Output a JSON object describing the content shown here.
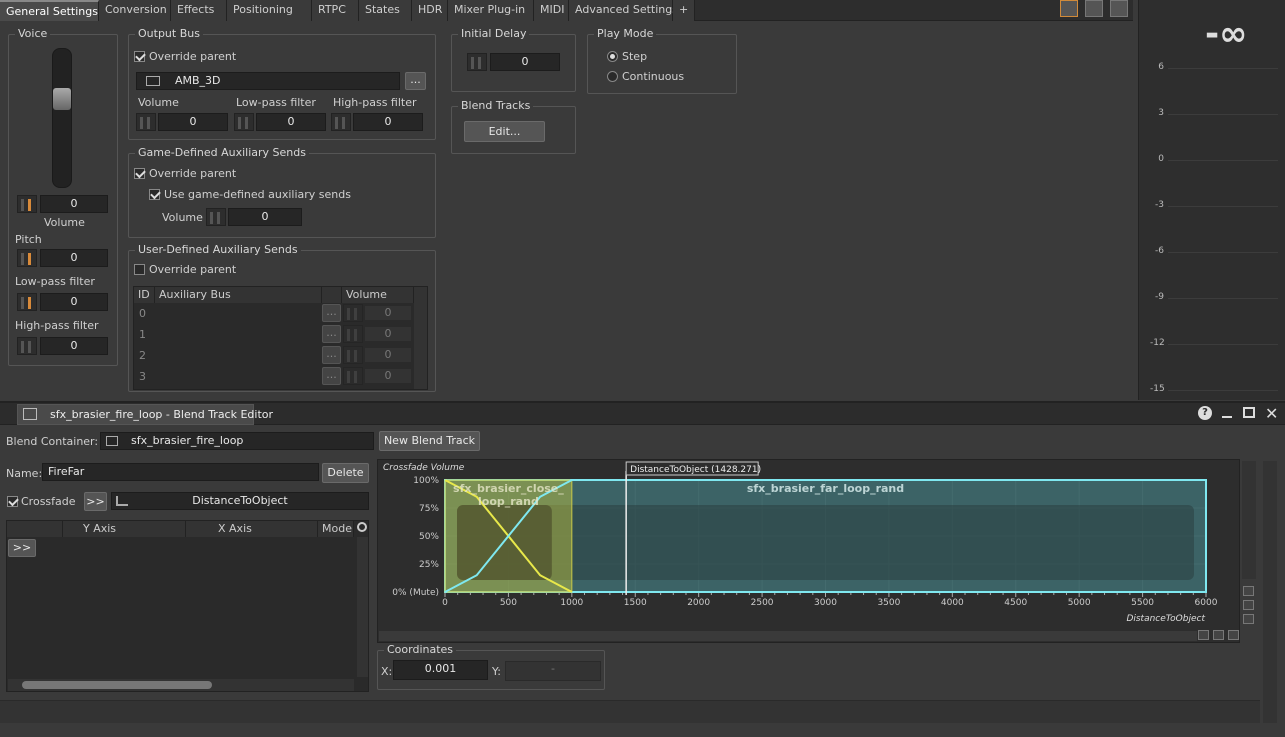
{
  "tabs": [
    "General Settings",
    "Conversion",
    "Effects",
    "Positioning",
    "RTPC",
    "States",
    "HDR",
    "Mixer Plug-in",
    "MIDI",
    "Advanced Settings",
    "+"
  ],
  "voice": {
    "title": "Voice",
    "volume_value": "0",
    "volume_label": "Volume",
    "pitch_label": "Pitch",
    "pitch_value": "0",
    "lowpass_label": "Low-pass filter",
    "lowpass_value": "0",
    "highpass_label": "High-pass filter",
    "highpass_value": "0"
  },
  "output_bus": {
    "title": "Output Bus",
    "override_label": "Override parent",
    "bus_name": "AMB_3D",
    "browse_label": "...",
    "volume_label": "Volume",
    "volume_value": "0",
    "lowpass_label": "Low-pass filter",
    "lowpass_value": "0",
    "highpass_label": "High-pass filter",
    "highpass_value": "0"
  },
  "game_aux": {
    "title": "Game-Defined Auxiliary Sends",
    "override_label": "Override parent",
    "use_label": "Use game-defined auxiliary sends",
    "volume_label": "Volume",
    "volume_value": "0"
  },
  "user_aux": {
    "title": "User-Defined Auxiliary Sends",
    "override_label": "Override parent",
    "columns": [
      "ID",
      "Auxiliary Bus",
      "Volume"
    ],
    "rows": [
      {
        "id": "0",
        "volume": "0"
      },
      {
        "id": "1",
        "volume": "0"
      },
      {
        "id": "2",
        "volume": "0"
      },
      {
        "id": "3",
        "volume": "0"
      }
    ],
    "row_button": "..."
  },
  "initial_delay": {
    "title": "Initial Delay",
    "value": "0"
  },
  "blend_tracks": {
    "title": "Blend Tracks",
    "edit_label": "Edit..."
  },
  "play_mode": {
    "title": "Play Mode",
    "options": [
      "Step",
      "Continuous"
    ],
    "selected": "Step"
  },
  "meter": {
    "peak": "-∞",
    "ticks": [
      "6",
      "3",
      "0",
      "-3",
      "-6",
      "-9",
      "-12",
      "-15"
    ]
  },
  "editor": {
    "title": "sfx_brasier_fire_loop - Blend Track Editor",
    "help": "?",
    "blend_container_label": "Blend Container:",
    "blend_container_value": "sfx_brasier_fire_loop",
    "new_blend_track": "New Blend Track",
    "name_label": "Name:",
    "name_value": "FireFar",
    "delete_label": "Delete",
    "crossfade_label": "Crossfade",
    "expand_label": ">>",
    "parameter": "DistanceToObject",
    "table_columns": [
      "Y Axis",
      "X Axis",
      "Mode"
    ],
    "graph_title": "Crossfade Volume",
    "cursor_label": "DistanceToObject (1428.271)",
    "x_axis_title": "DistanceToObject",
    "y_ticks": [
      "100%",
      "75%",
      "50%",
      "25%",
      "0% (Mute)"
    ],
    "x_ticks": [
      "0",
      "500",
      "1000",
      "1500",
      "2000",
      "2500",
      "3000",
      "3500",
      "4000",
      "4500",
      "5000",
      "5500",
      "6000"
    ],
    "track_close": "sfx_brasier_close_loop_rand",
    "track_far": "sfx_brasier_far_loop_rand",
    "coordinates_title": "Coordinates",
    "x_label": "X:",
    "x_value": "0.001",
    "y_label": "Y:",
    "y_value": "-"
  },
  "chart_data": {
    "type": "line",
    "title": "Crossfade Volume",
    "xlabel": "DistanceToObject",
    "ylabel": "",
    "xlim": [
      0,
      6000
    ],
    "ylim": [
      0,
      100
    ],
    "x_ticks": [
      0,
      500,
      1000,
      1500,
      2000,
      2500,
      3000,
      3500,
      4000,
      4500,
      5000,
      5500,
      6000
    ],
    "y_ticks": [
      0,
      25,
      50,
      75,
      100
    ],
    "series": [
      {
        "name": "sfx_brasier_close_loop_rand",
        "x": [
          0,
          250,
          500,
          750,
          1000
        ],
        "y": [
          100,
          85,
          50,
          15,
          0
        ],
        "range": [
          0,
          1000
        ]
      },
      {
        "name": "sfx_brasier_far_loop_rand",
        "x": [
          0,
          250,
          500,
          750,
          1000,
          6000
        ],
        "y": [
          0,
          15,
          50,
          85,
          100,
          100
        ],
        "range": [
          0,
          6000
        ]
      }
    ],
    "cursor_x": 1428.271
  }
}
